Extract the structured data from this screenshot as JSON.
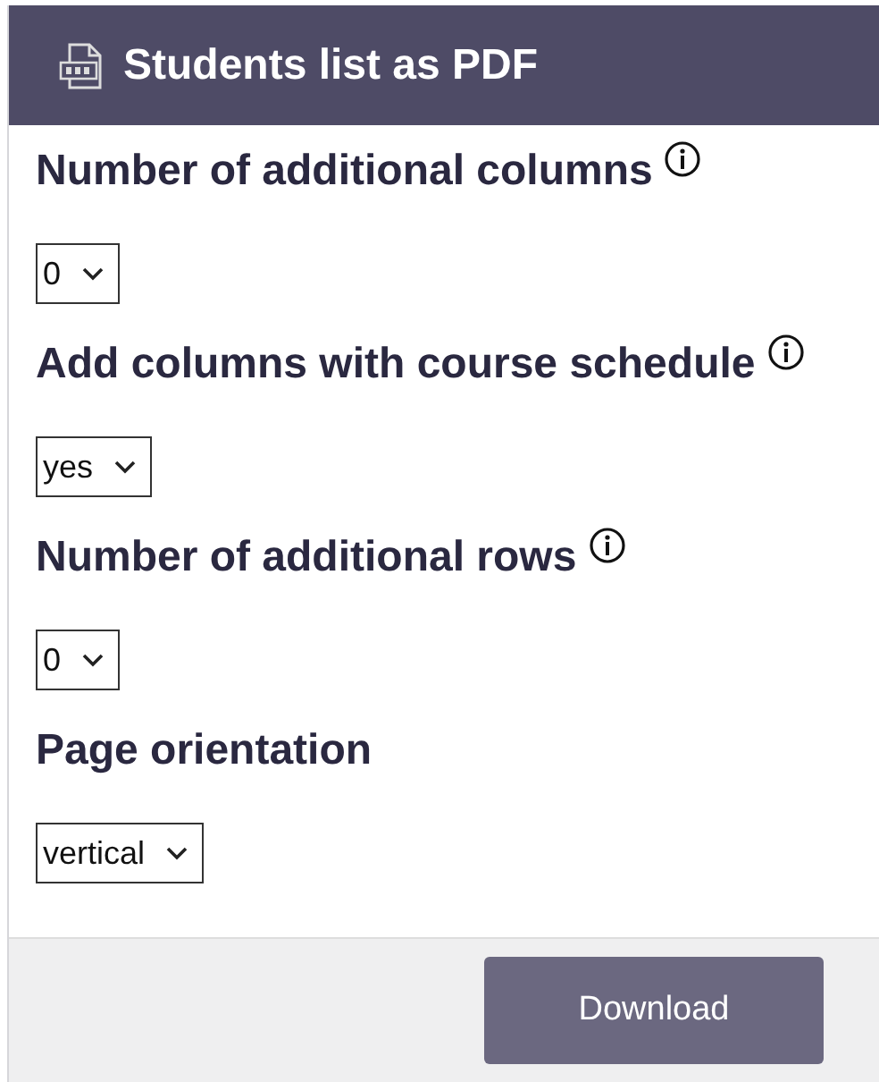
{
  "panel": {
    "title": "Students list as PDF"
  },
  "fields": [
    {
      "label": "Number of additional columns",
      "info": true,
      "value": "0"
    },
    {
      "label": "Add columns with course schedule",
      "info": true,
      "value": "yes"
    },
    {
      "label": "Number of additional rows",
      "info": true,
      "value": "0"
    },
    {
      "label": "Page orientation",
      "info": false,
      "value": "vertical"
    }
  ],
  "buttons": [
    {
      "label": "Download"
    }
  ]
}
